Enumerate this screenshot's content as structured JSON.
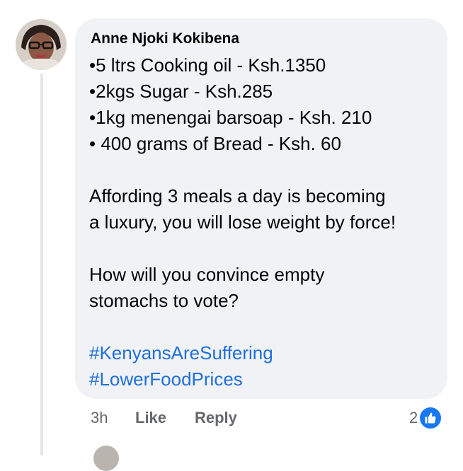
{
  "comment": {
    "author": "Anne Njoki Kokibena",
    "lines": [
      "•5 ltrs Cooking oil - Ksh.1350",
      "•2kgs Sugar - Ksh.285",
      "•1kg menengai barsoap - Ksh. 210",
      "• 400 grams of Bread - Ksh. 60"
    ],
    "paragraph1": [
      "Affording 3 meals a day is becoming",
      "a luxury, you will lose weight by force!"
    ],
    "paragraph2": [
      "How will you convince empty",
      "stomachs to vote?"
    ],
    "hashtags": [
      "#KenyansAreSuffering",
      "#LowerFoodPrices"
    ]
  },
  "actions": {
    "time": "3h",
    "like_label": "Like",
    "reply_label": "Reply",
    "reaction_count": "2",
    "reaction_icon": "thumbs-up-icon"
  },
  "colors": {
    "bubble": "#f0f2f5",
    "hashtag": "#216fdb",
    "meta": "#65676b",
    "like_badge": "#1877f2"
  }
}
